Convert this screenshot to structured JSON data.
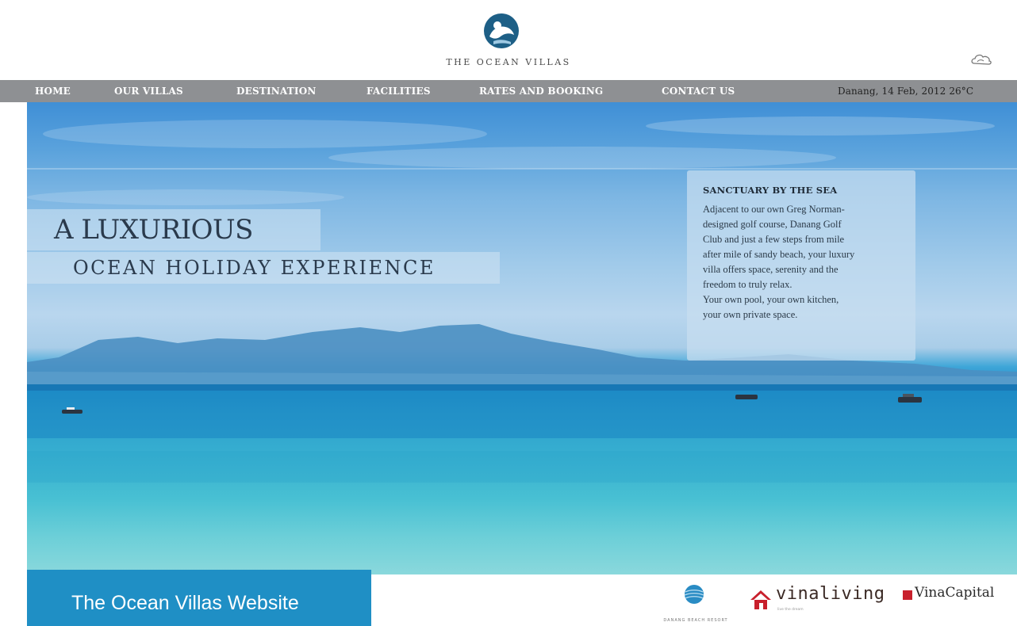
{
  "brand": {
    "name": "THE OCEAN VILLAS",
    "logo_icon": "ocean-villas-emblem-icon",
    "weather_icon": "cloud-icon"
  },
  "nav": {
    "items": [
      {
        "label": "HOME"
      },
      {
        "label": "OUR VILLAS"
      },
      {
        "label": "DESTINATION"
      },
      {
        "label": "FACILITIES"
      },
      {
        "label": "RATES AND BOOKING"
      },
      {
        "label": "CONTACT US"
      }
    ],
    "date_weather": "Danang, 14 Feb, 2012  26°C",
    "bar_color": "#8e9093"
  },
  "hero": {
    "headline_line1": "A LUXURIOUS",
    "headline_line2": "OCEAN HOLIDAY EXPERIENCE",
    "info_title": "SANCTUARY BY THE SEA",
    "info_lines": [
      "Adjacent to our own Greg Norman-",
      "designed golf course, Danang Golf",
      "Club and just a few steps from mile",
      "after mile of sandy beach, your luxury",
      "villa offers space, serenity and the",
      "freedom to truly relax.",
      "Your own pool, your own kitchen,",
      "your own private space."
    ]
  },
  "caption": {
    "text": "The Ocean Villas Website",
    "color": "#1f8fc5"
  },
  "sponsors": {
    "danang_label": "DANANG BEACH RESORT",
    "vinaliving_name": "vinaliving",
    "vinaliving_tagline": "live the dream",
    "vinacapital_name": "VinaCapital"
  }
}
